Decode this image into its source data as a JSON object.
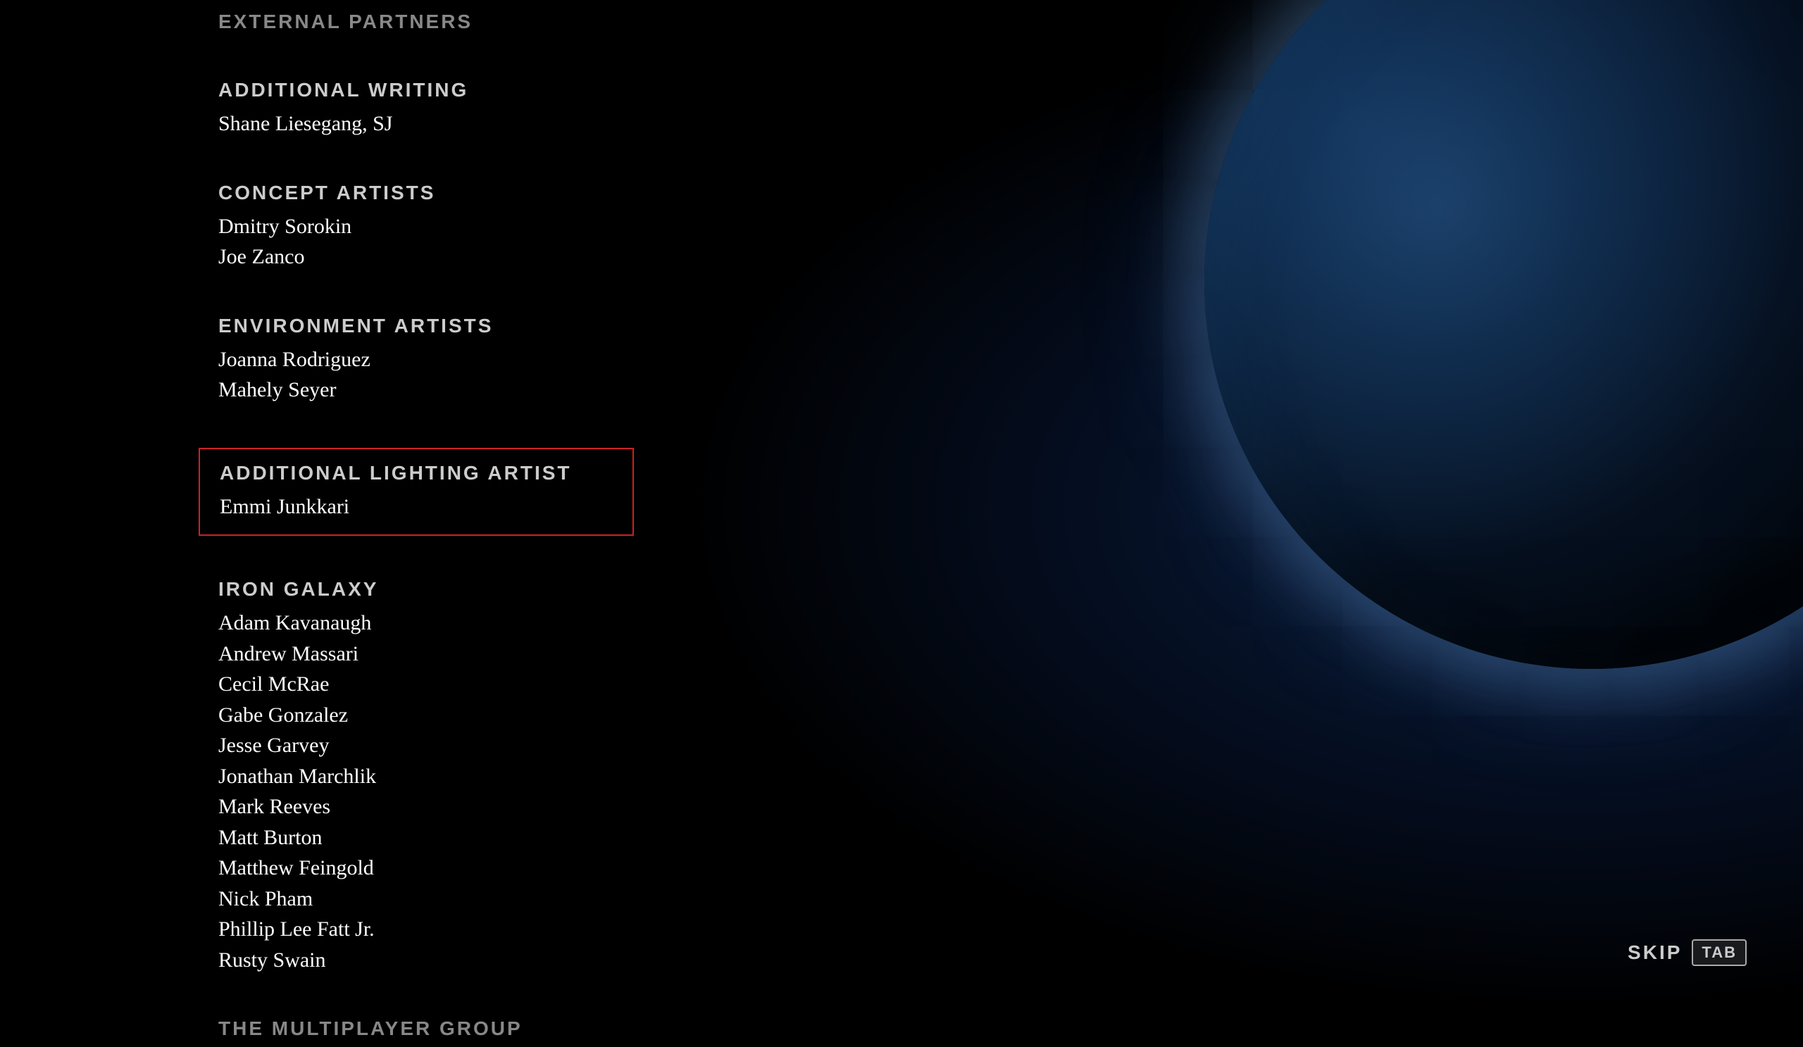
{
  "background": {
    "description": "Space scene with planet"
  },
  "credits": {
    "external_partners_label": "EXTERNAL PARTNERS",
    "sections": [
      {
        "id": "additional-writing",
        "role": "ADDITIONAL WRITING",
        "names": [
          "Shane Liesegang, SJ"
        ],
        "highlighted": false
      },
      {
        "id": "concept-artists",
        "role": "CONCEPT ARTISTS",
        "names": [
          "Dmitry Sorokin",
          "Joe Zanco"
        ],
        "highlighted": false
      },
      {
        "id": "environment-artists",
        "role": "ENVIRONMENT ARTISTS",
        "names": [
          "Joanna Rodriguez",
          "Mahely Seyer"
        ],
        "highlighted": false
      },
      {
        "id": "additional-lighting-artist",
        "role": "ADDITIONAL LIGHTING ARTIST",
        "names": [
          "Emmi Junkkari"
        ],
        "highlighted": true
      },
      {
        "id": "iron-galaxy",
        "role": "IRON GALAXY",
        "names": [
          "Adam Kavanaugh",
          "Andrew Massari",
          "Cecil McRae",
          "Gabe Gonzalez",
          "Jesse Garvey",
          "Jonathan Marchlik",
          "Mark Reeves",
          "Matt Burton",
          "Matthew Feingold",
          "Nick Pham",
          "Phillip Lee Fatt Jr.",
          "Rusty Swain"
        ],
        "highlighted": false
      },
      {
        "id": "multiplayer-group",
        "role": "THE MULTIPLAYER GROUP",
        "names": [],
        "highlighted": false
      }
    ]
  },
  "skip_button": {
    "label": "SKIP",
    "key": "TAB"
  }
}
